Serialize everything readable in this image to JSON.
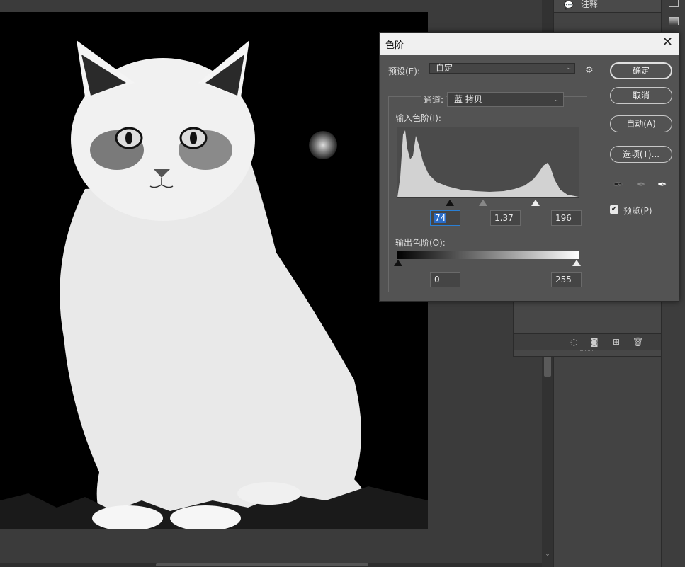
{
  "panel": {
    "tab_label": "注释"
  },
  "dialog": {
    "title": "色阶",
    "preset_label": "预设(E):",
    "preset_value": "自定",
    "channel_label": "通道:",
    "channel_value": "蓝 拷贝",
    "input_label": "输入色阶(I):",
    "input_black": "74",
    "input_gamma": "1.37",
    "input_white": "196",
    "output_label": "输出色阶(O):",
    "output_black": "0",
    "output_white": "255",
    "buttons": {
      "ok": "确定",
      "cancel": "取消",
      "auto": "自动(A)",
      "options": "选项(T)..."
    },
    "preview_label": "预览(P)",
    "preview_checked": true
  },
  "icons": [
    "comment-icon",
    "gear-icon",
    "close-icon",
    "eyedropper-black-icon",
    "eyedropper-gray-icon",
    "eyedropper-white-icon",
    "checkbox-icon",
    "new-layer-icon",
    "trash-icon",
    "mask-icon",
    "selection-icon"
  ]
}
